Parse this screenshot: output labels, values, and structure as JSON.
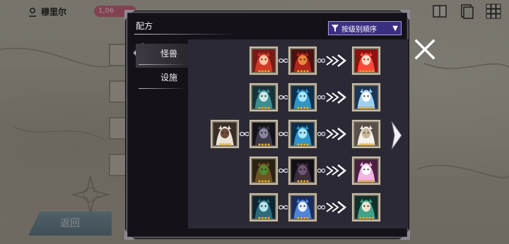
{
  "background": {
    "player_name": "穆里尔",
    "currency": "1,06",
    "back_label": "返回"
  },
  "dialog": {
    "title": "配方",
    "sort_label": "按级别顺序",
    "tabs": [
      {
        "label": "怪兽",
        "active": true
      },
      {
        "label": "设施",
        "active": false
      }
    ]
  },
  "recipes": [
    {
      "ingredients": [
        {
          "name": "red-beast",
          "stars": "★★★★"
        },
        {
          "name": "red-dragon",
          "stars": "★★★★"
        }
      ],
      "result": {
        "name": "fire-girl",
        "stars": "★★★★★"
      }
    },
    {
      "ingredients": [
        {
          "name": "teal-mermaid",
          "stars": "★★★★"
        },
        {
          "name": "blue-blob",
          "stars": "★★★★"
        }
      ],
      "result": {
        "name": "ice-wolf",
        "stars": "★★★★★"
      }
    },
    {
      "ingredients": [
        {
          "name": "white-hair-girl",
          "stars": "★★★★"
        },
        {
          "name": "dark-imp",
          "stars": "★★★★"
        },
        {
          "name": "blue-blob",
          "stars": "★★★★"
        }
      ],
      "result": {
        "name": "white-angel",
        "stars": "★★★★★"
      }
    },
    {
      "ingredients": [
        {
          "name": "tree-ent",
          "stars": "★★★★"
        },
        {
          "name": "shadow-bat",
          "stars": "★★★★"
        }
      ],
      "result": {
        "name": "pink-fairy",
        "stars": "★★★★★"
      }
    },
    {
      "ingredients": [
        {
          "name": "teal-witch",
          "stars": "★★★★"
        },
        {
          "name": "blue-knight",
          "stars": "★★★★"
        }
      ],
      "result": {
        "name": "green-siren",
        "stars": "★★★★★"
      }
    }
  ],
  "colors": {
    "frame": "#c7bfae",
    "sort_bg": "#3b2f82",
    "content_bg": "#2c2936",
    "star": "#ffc22e"
  }
}
